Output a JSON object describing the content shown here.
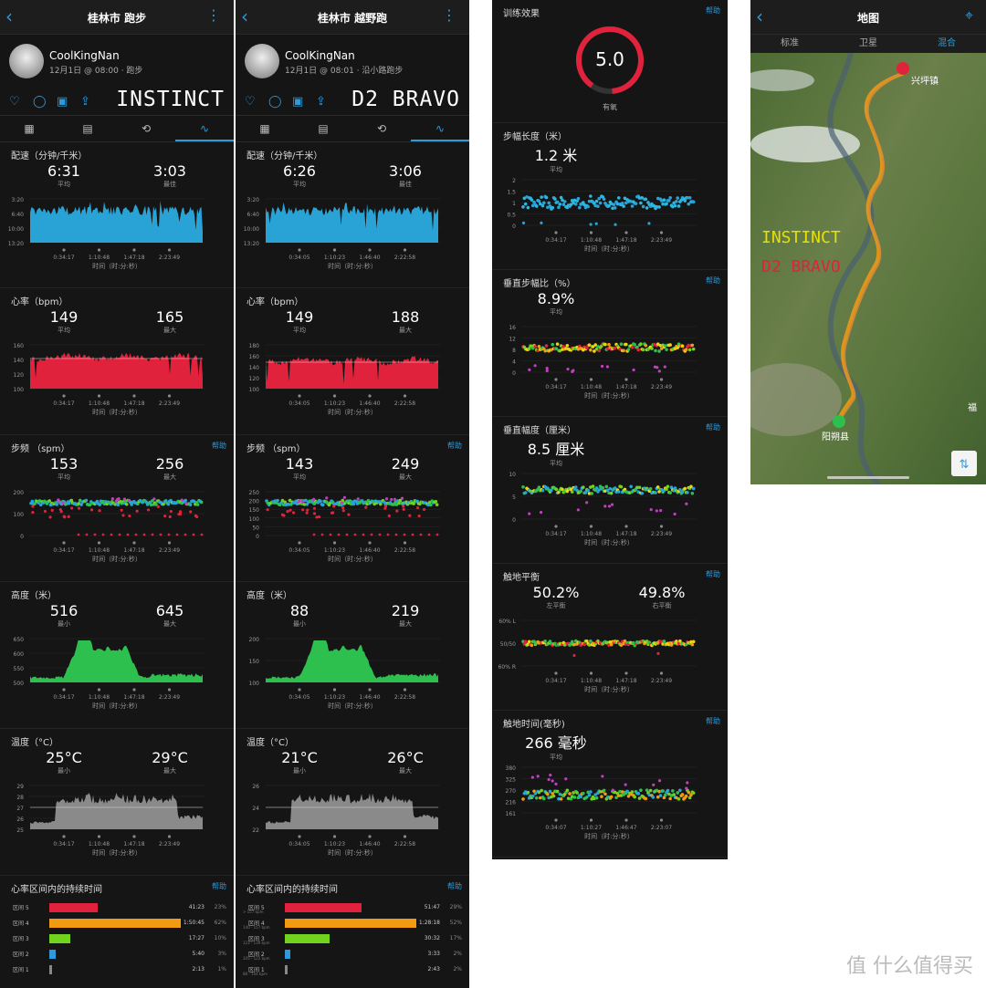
{
  "colors": {
    "pace": "#29a3d6",
    "hr": "#e0223c",
    "elev": "#2ec04e",
    "temp": "#8a8a8a",
    "accent": "#2d9bdb"
  },
  "panel1": {
    "title": "桂林市 跑步",
    "user": "CoolKingNan",
    "meta": "12月1日 @ 08:00 · 跑步",
    "watch": "INSTINCT",
    "xticks": [
      "0:34:17",
      "1:10:48",
      "1:47:18",
      "2:23:49"
    ],
    "xlabel": "时间（时:分:秒）",
    "pace": {
      "title": "配速（分钟/千米）",
      "a": "6:31",
      "al": "平均",
      "b": "3:03",
      "bl": "最佳",
      "yticks": [
        "3:20",
        "6:40",
        "10:00",
        "13:20"
      ]
    },
    "hr": {
      "title": "心率（bpm）",
      "a": "149",
      "al": "平均",
      "b": "165",
      "bl": "最大",
      "yticks": [
        "160",
        "140",
        "120",
        "100"
      ]
    },
    "cad": {
      "title": "步频 （spm）",
      "help": "帮助",
      "a": "153",
      "al": "平均",
      "b": "256",
      "bl": "最大",
      "yticks": [
        "200",
        "100",
        "0"
      ]
    },
    "elev": {
      "title": "高度（米）",
      "a": "516",
      "al": "最小",
      "b": "645",
      "bl": "最大",
      "yticks": [
        "650",
        "600",
        "550",
        "500"
      ]
    },
    "temp": {
      "title": "温度（°C）",
      "a": "25°C",
      "al": "最小",
      "b": "29°C",
      "bl": "最大",
      "yticks": [
        "29",
        "28",
        "27",
        "26",
        "25"
      ]
    },
    "zones": {
      "title": "心率区间内的持续时间",
      "help": "帮助",
      "rows": [
        {
          "label": "区间 5",
          "sub": "",
          "time": "41:23",
          "pct": "23%",
          "frac": 0.37,
          "color": "#e0223c"
        },
        {
          "label": "区间 4",
          "sub": "",
          "time": "1:50:45",
          "pct": "62%",
          "frac": 1.0,
          "color": "#f39a13"
        },
        {
          "label": "区间 3",
          "sub": "",
          "time": "17:27",
          "pct": "10%",
          "frac": 0.16,
          "color": "#72d31e"
        },
        {
          "label": "区间 2",
          "sub": "",
          "time": "5:40",
          "pct": "3%",
          "frac": 0.05,
          "color": "#2d9bdb"
        },
        {
          "label": "区间 1",
          "sub": "",
          "time": "2:13",
          "pct": "1%",
          "frac": 0.02,
          "color": "#888888"
        }
      ]
    }
  },
  "panel2": {
    "title": "桂林市 越野跑",
    "user": "CoolKingNan",
    "meta": "12月1日 @ 08:01 · 沿小路跑步",
    "watch": "D2 BRAVO",
    "xticks": [
      "0:34:05",
      "1:10:23",
      "1:46:40",
      "2:22:58"
    ],
    "xlabel": "时间（时:分:秒）",
    "pace": {
      "title": "配速（分钟/千米）",
      "a": "6:26",
      "al": "平均",
      "b": "3:06",
      "bl": "最佳",
      "yticks": [
        "3:20",
        "6:40",
        "10:00",
        "13:20"
      ]
    },
    "hr": {
      "title": "心率（bpm）",
      "a": "149",
      "al": "平均",
      "b": "188",
      "bl": "最大",
      "yticks": [
        "180",
        "160",
        "140",
        "120",
        "100"
      ]
    },
    "cad": {
      "title": "步频 （spm）",
      "help": "帮助",
      "a": "143",
      "al": "平均",
      "b": "249",
      "bl": "最大",
      "yticks": [
        "250",
        "200",
        "150",
        "100",
        "50",
        "0"
      ]
    },
    "elev": {
      "title": "高度（米）",
      "a": "88",
      "al": "最小",
      "b": "219",
      "bl": "最大",
      "yticks": [
        "200",
        "150",
        "100"
      ]
    },
    "temp": {
      "title": "温度（°C）",
      "a": "21°C",
      "al": "最小",
      "b": "26°C",
      "bl": "最大",
      "yticks": [
        "26",
        "24",
        "22"
      ]
    },
    "zones": {
      "title": "心率区间内的持续时间",
      "help": "帮助",
      "rows": [
        {
          "label": "区间 5",
          "sub": "> 157 bpm",
          "time": "51:47",
          "pct": "29%",
          "frac": 0.58,
          "color": "#e0223c"
        },
        {
          "label": "区间 4",
          "sub": "140 - 157 bpm",
          "time": "1:28:18",
          "pct": "52%",
          "frac": 1.0,
          "color": "#f39a13"
        },
        {
          "label": "区间 3",
          "sub": "123 - 139 bpm",
          "time": "30:32",
          "pct": "17%",
          "frac": 0.34,
          "color": "#72d31e"
        },
        {
          "label": "区间 2",
          "sub": "105 - 122 bpm",
          "time": "3:33",
          "pct": "2%",
          "frac": 0.04,
          "color": "#2d9bdb"
        },
        {
          "label": "区间 1",
          "sub": "88 - 104 bpm",
          "time": "2:43",
          "pct": "2%",
          "frac": 0.02,
          "color": "#888888"
        }
      ]
    }
  },
  "panel3": {
    "training": {
      "title": "训练效果",
      "help": "帮助",
      "value": "5.0",
      "label": "有氧"
    },
    "xticks": [
      "0:34:17",
      "1:10:48",
      "1:47:18",
      "2:23:49"
    ],
    "xticks_gct": [
      "0:34:07",
      "1:10:27",
      "1:46:47",
      "2:23:07"
    ],
    "xlabel": "时间（时:分:秒）",
    "stride": {
      "title": "步幅长度（米）",
      "a": "1.2 米",
      "al": "平均",
      "yticks": [
        "2",
        "1.5",
        "1",
        "0.5",
        "0"
      ]
    },
    "vratio": {
      "title": "垂直步幅比（%）",
      "help": "帮助",
      "a": "8.9%",
      "al": "平均",
      "yticks": [
        "16",
        "12",
        "8",
        "4",
        "0"
      ]
    },
    "vosc": {
      "title": "垂直幅度（厘米）",
      "help": "帮助",
      "a": "8.5 厘米",
      "al": "平均",
      "yticks": [
        "10",
        "5",
        "0"
      ]
    },
    "balance": {
      "title": "触地平衡",
      "help": "帮助",
      "a": "50.2%",
      "al": "左平衡",
      "b": "49.8%",
      "bl": "右平衡",
      "yticks": [
        "60% L",
        "50/50",
        "60% R"
      ]
    },
    "gct": {
      "title": "触地时间(毫秒)",
      "help": "帮助",
      "a": "266 毫秒",
      "al": "平均",
      "yticks": [
        "380",
        "325",
        "270",
        "216",
        "161"
      ]
    }
  },
  "panel4": {
    "title": "地图",
    "tabs": [
      "标准",
      "卫星",
      "混合"
    ],
    "labels": {
      "end": "兴坪镇",
      "start": "阳朔县",
      "edge": "福",
      "w1": "INSTINCT",
      "w2": "D2 BRAVO"
    }
  },
  "watermark": "值 什么值得买"
}
